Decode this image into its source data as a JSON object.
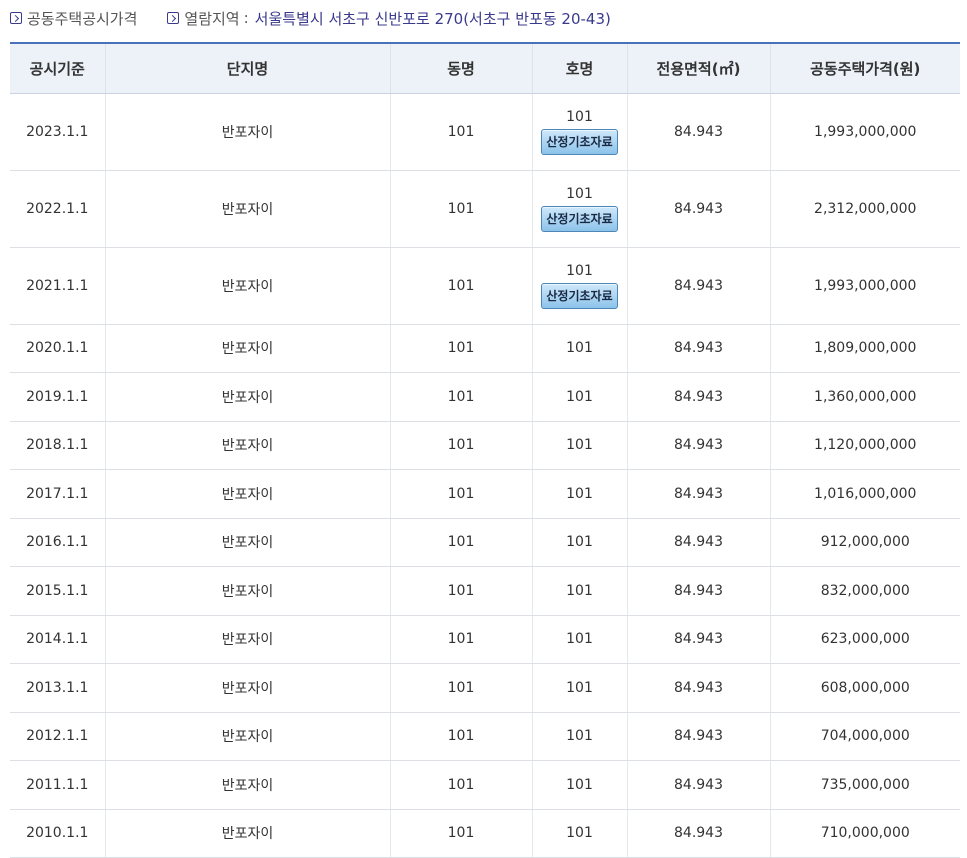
{
  "breadcrumb": {
    "section": "공동주택공시가격",
    "region_label": "열람지역",
    "separator": ":",
    "address": "서울특별시 서초구 신반포로 270(서초구 반포동 20-43)"
  },
  "table": {
    "headers": [
      "공시기준",
      "단지명",
      "동명",
      "호명",
      "전용면적(㎡)",
      "공동주택가격(원)"
    ],
    "button_label": "산정기초자료",
    "rows": [
      {
        "date": "2023.1.1",
        "complex": "반포자이",
        "dong": "101",
        "ho": "101",
        "area": "84.943",
        "price": "1,993,000,000"
      },
      {
        "date": "2022.1.1",
        "complex": "반포자이",
        "dong": "101",
        "ho": "101",
        "area": "84.943",
        "price": "2,312,000,000"
      },
      {
        "date": "2021.1.1",
        "complex": "반포자이",
        "dong": "101",
        "ho": "101",
        "area": "84.943",
        "price": "1,993,000,000"
      },
      {
        "date": "2020.1.1",
        "complex": "반포자이",
        "dong": "101",
        "ho": "101",
        "area": "84.943",
        "price": "1,809,000,000"
      },
      {
        "date": "2019.1.1",
        "complex": "반포자이",
        "dong": "101",
        "ho": "101",
        "area": "84.943",
        "price": "1,360,000,000"
      },
      {
        "date": "2018.1.1",
        "complex": "반포자이",
        "dong": "101",
        "ho": "101",
        "area": "84.943",
        "price": "1,120,000,000"
      },
      {
        "date": "2017.1.1",
        "complex": "반포자이",
        "dong": "101",
        "ho": "101",
        "area": "84.943",
        "price": "1,016,000,000"
      },
      {
        "date": "2016.1.1",
        "complex": "반포자이",
        "dong": "101",
        "ho": "101",
        "area": "84.943",
        "price": "912,000,000"
      },
      {
        "date": "2015.1.1",
        "complex": "반포자이",
        "dong": "101",
        "ho": "101",
        "area": "84.943",
        "price": "832,000,000"
      },
      {
        "date": "2014.1.1",
        "complex": "반포자이",
        "dong": "101",
        "ho": "101",
        "area": "84.943",
        "price": "623,000,000"
      },
      {
        "date": "2013.1.1",
        "complex": "반포자이",
        "dong": "101",
        "ho": "101",
        "area": "84.943",
        "price": "608,000,000"
      },
      {
        "date": "2012.1.1",
        "complex": "반포자이",
        "dong": "101",
        "ho": "101",
        "area": "84.943",
        "price": "704,000,000"
      },
      {
        "date": "2011.1.1",
        "complex": "반포자이",
        "dong": "101",
        "ho": "101",
        "area": "84.943",
        "price": "735,000,000"
      },
      {
        "date": "2010.1.1",
        "complex": "반포자이",
        "dong": "101",
        "ho": "101",
        "area": "84.943",
        "price": "710,000,000"
      }
    ]
  },
  "colors": {
    "header_bg": "#edf2f8",
    "header_top_border": "#4a72b8",
    "address_text": "#3a3a8c",
    "button_bg": "#8cc3ea"
  },
  "icons": {
    "breadcrumb": "chevron-right-box-icon"
  }
}
